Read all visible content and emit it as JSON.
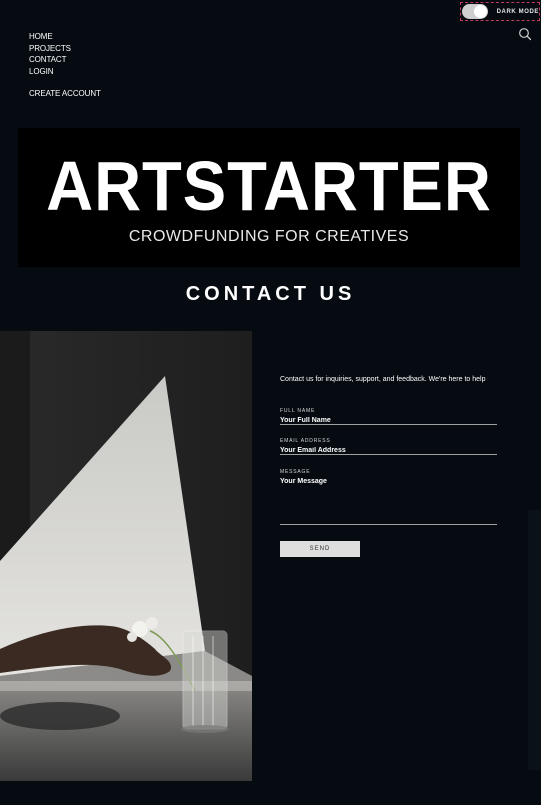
{
  "toggle": {
    "label": "DARK MODE",
    "on": true
  },
  "nav": {
    "items": [
      {
        "label": "HOME"
      },
      {
        "label": "PROJECTS"
      },
      {
        "label": "CONTACT"
      },
      {
        "label": "LOGIN"
      },
      {
        "label": "CREATE ACCOUNT"
      }
    ]
  },
  "banner": {
    "logo": "ARTSTARTER",
    "tagline": "CROWDFUNDING FOR CREATIVES"
  },
  "page": {
    "title": "CONTACT US"
  },
  "form": {
    "intro": "Contact us for inquiries, support, and feedback. We're here to help",
    "name_label": "FULL NAME",
    "name_placeholder": "Your Full Name",
    "email_label": "EMAIL ADDRESS",
    "email_placeholder": "Your Email Address",
    "message_label": "MESSAGE",
    "message_placeholder": "Your Message",
    "send_label": "SEND"
  },
  "icons": {
    "search": "search-icon"
  },
  "colors": {
    "background": "#050b10",
    "banner": "#000000",
    "button": "#dedede"
  }
}
